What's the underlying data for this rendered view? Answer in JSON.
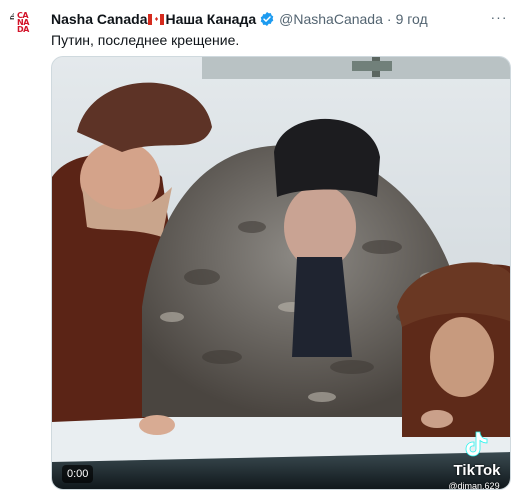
{
  "account": {
    "avatar_small_text": "nasha",
    "avatar_big_text": [
      "CA",
      "NA",
      "DA"
    ],
    "display_name_en": "Nasha Canada",
    "display_name_ru": "Наша Канада",
    "handle": "@NashaCanada",
    "separator": "·",
    "time": "9 год",
    "verified": true
  },
  "tweet": {
    "text": "Путин, последнее крещение."
  },
  "more_menu": {
    "label": "···"
  },
  "media": {
    "type": "video",
    "timestamp": "0:00",
    "watermark_brand": "TikTok",
    "watermark_user": "@diman.629"
  },
  "colors": {
    "verified": "#1d9bf0",
    "flag_red": "#d52b1e",
    "secondary_text": "#536471"
  }
}
